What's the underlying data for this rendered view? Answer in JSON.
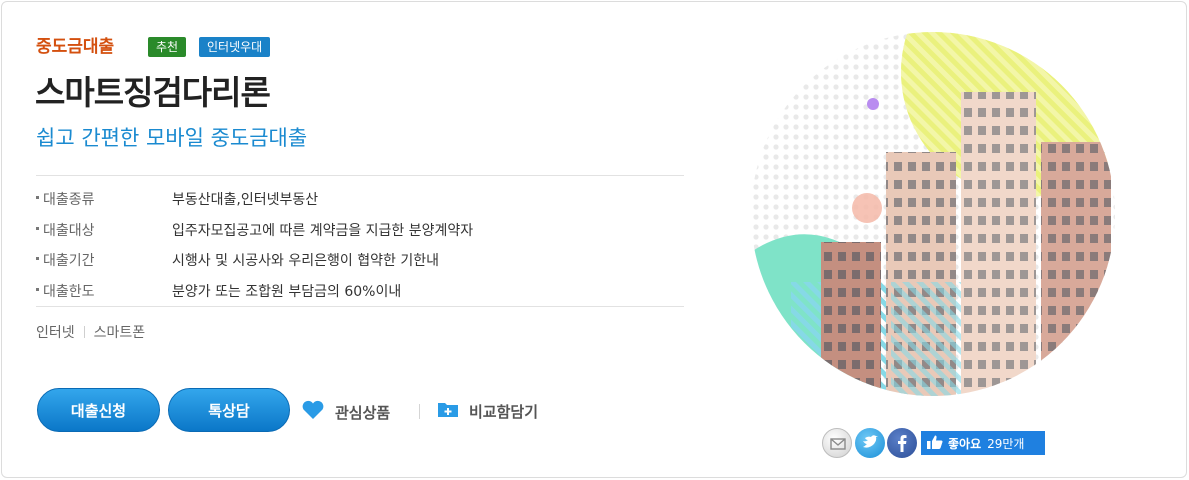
{
  "product": {
    "category": "중도금대출",
    "badges": {
      "recommend": "추천",
      "internet": "인터넷우대"
    },
    "title": "스마트징검다리론",
    "subtitle": "쉽고 간편한 모바일 중도금대출"
  },
  "info": [
    {
      "key": "대출종류",
      "value": "부동산대출,인터넷부동산"
    },
    {
      "key": "대출대상",
      "value": "입주자모집공고에 따른 계약금을 지급한 분양계약자"
    },
    {
      "key": "대출기간",
      "value": "시행사 및 시공사와 우리은행이 협약한 기한내"
    },
    {
      "key": "대출한도",
      "value": "분양가 또는 조합원 부담금의 60%이내"
    }
  ],
  "channels": [
    "인터넷",
    "스마트폰"
  ],
  "actions": {
    "apply": "대출신청",
    "consult": "톡상담",
    "favorite": "관심상품",
    "compare": "비교함담기"
  },
  "social": {
    "like_label": "좋아요",
    "like_count": "29만개",
    "icons": [
      "mail-icon",
      "twitter-icon",
      "facebook-icon",
      "thumbs-up-icon"
    ]
  },
  "colors": {
    "category": "#d4500f",
    "recommend_badge": "#2a8a2a",
    "internet_badge": "#1a82c8",
    "subtitle": "#1a8ad0",
    "button": "#1a8ad8",
    "like": "#1f80e0"
  }
}
